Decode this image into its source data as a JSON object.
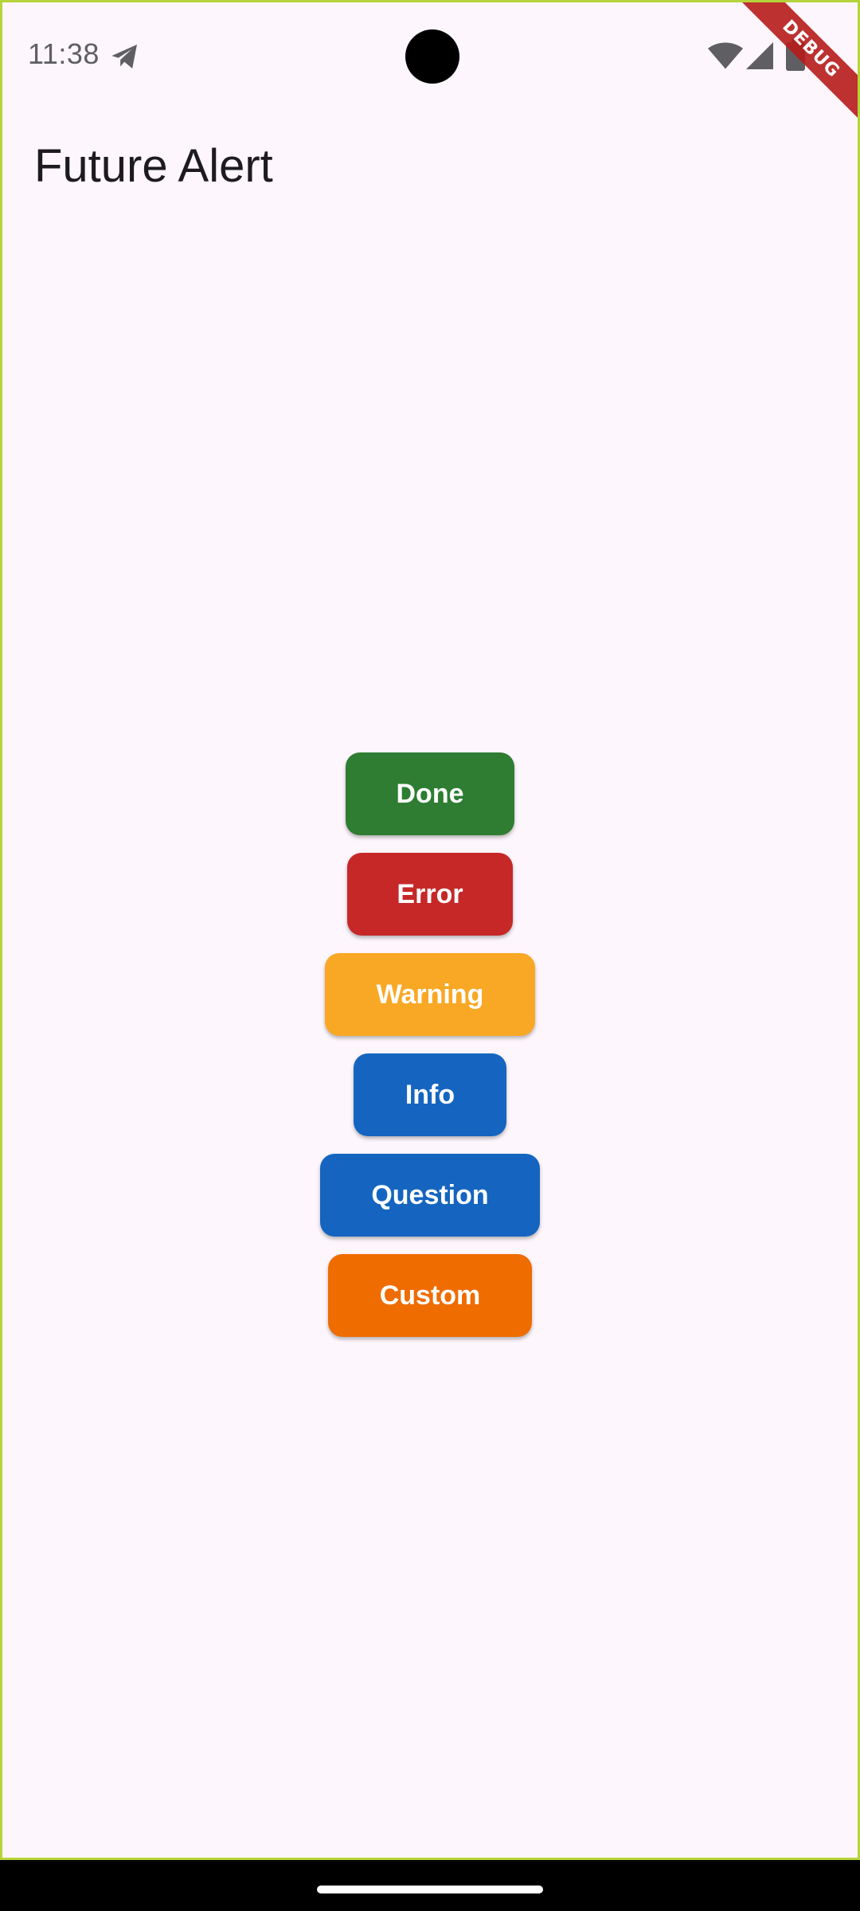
{
  "status_bar": {
    "time": "11:38",
    "icons": [
      "telegram-icon",
      "wifi-icon",
      "signal-icon",
      "battery-icon"
    ]
  },
  "debug_banner": "DEBUG",
  "app_bar": {
    "title": "Future Alert"
  },
  "buttons": [
    {
      "label": "Done",
      "color": "#2e7d32"
    },
    {
      "label": "Error",
      "color": "#c62828"
    },
    {
      "label": "Warning",
      "color": "#f9a825"
    },
    {
      "label": "Info",
      "color": "#1565c0"
    },
    {
      "label": "Question",
      "color": "#1565c0"
    },
    {
      "label": "Custom",
      "color": "#ef6c00"
    }
  ],
  "colors": {
    "background": "#fdf6fc",
    "border": "#b5d43a"
  }
}
